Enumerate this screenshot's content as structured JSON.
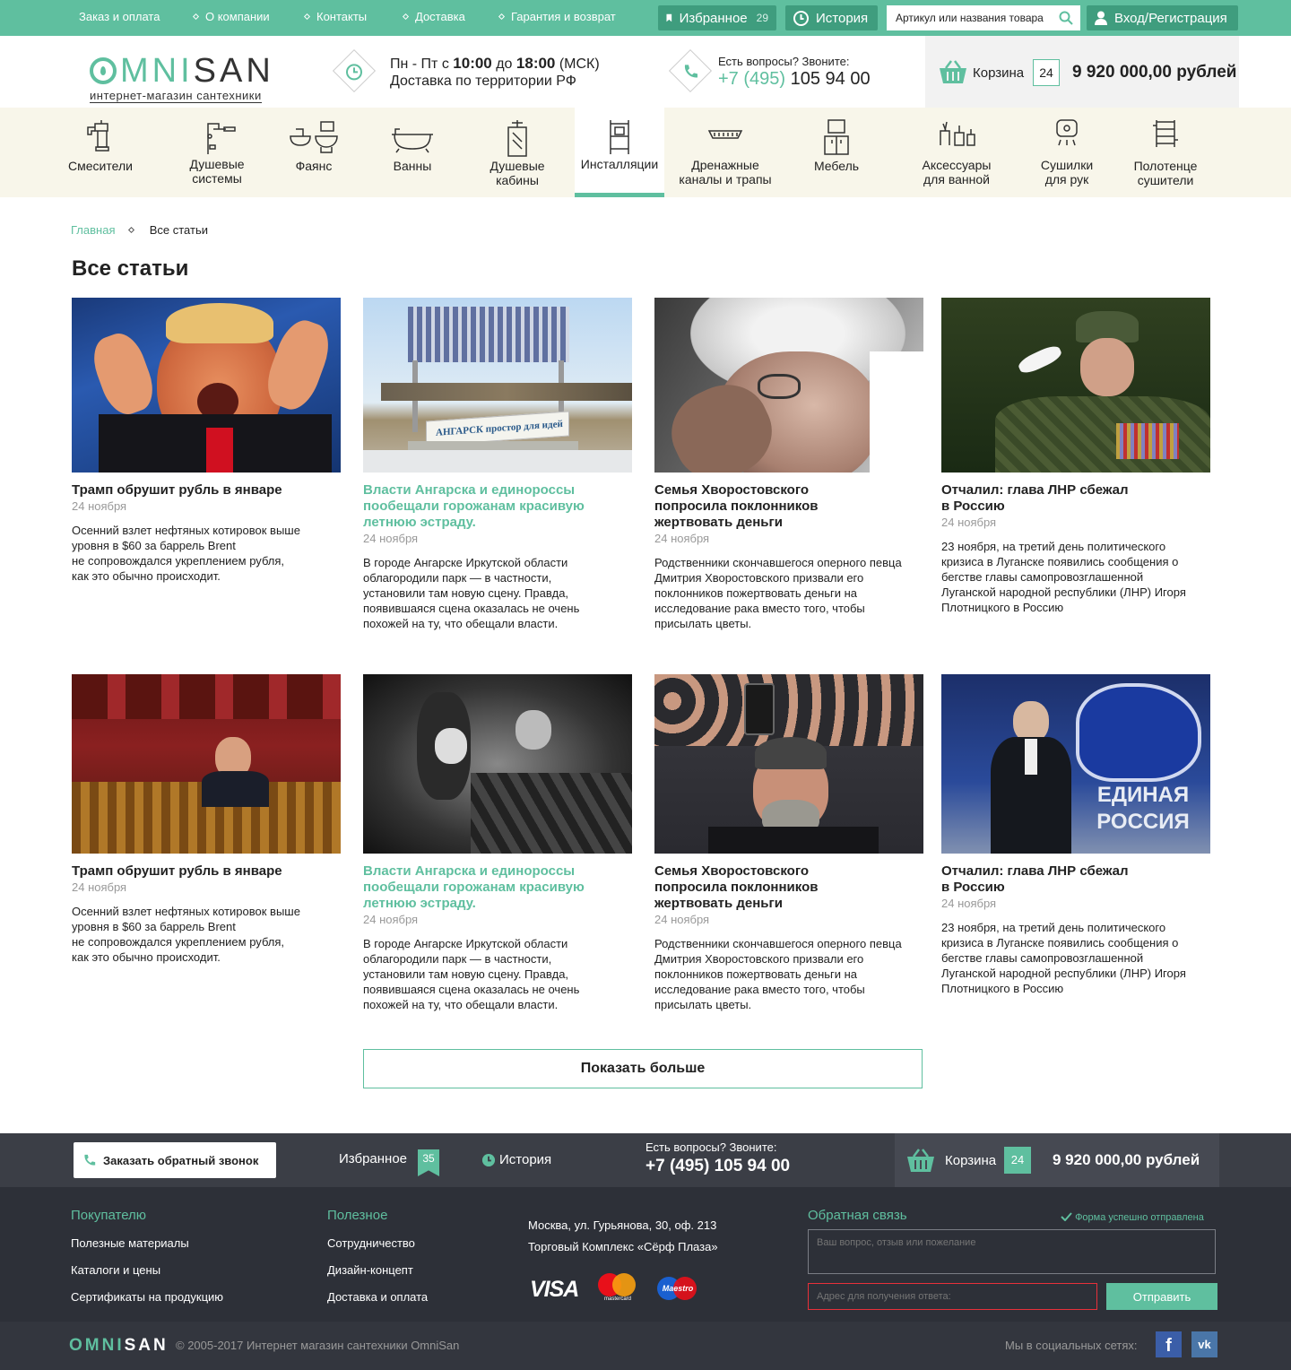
{
  "topbar": {
    "nav": [
      "Заказ и оплата",
      "О компании",
      "Контакты",
      "Доставка",
      "Гарантия и возврат"
    ],
    "favorites_label": "Избранное",
    "favorites_count": "29",
    "history_label": "История",
    "search_placeholder": "Артикул или названия товара",
    "login_label": "Вход/Регистрация"
  },
  "header": {
    "logo_omni_o": "O",
    "logo_mni": "MNI",
    "logo_san": "SAN",
    "logo_sub": "интернет-магазин сантехники",
    "hours_prefix": "Пн - Пт с",
    "hours_from": "10:00",
    "hours_mid": "до",
    "hours_to": "18:00",
    "hours_suffix": "(МСК)",
    "delivery": "Доставка по территории РФ",
    "phone_question": "Есть вопросы? Звоните:",
    "phone_code": "+7 (495)",
    "phone_number": "105 94 00",
    "cart_label": "Корзина",
    "cart_count": "24",
    "cart_total": "9 920 000,00 рублей"
  },
  "categories": [
    {
      "l1": "Смесители",
      "l2": ""
    },
    {
      "l1": "Душевые",
      "l2": "системы"
    },
    {
      "l1": "Фаянс",
      "l2": ""
    },
    {
      "l1": "Ванны",
      "l2": ""
    },
    {
      "l1": "Душевые",
      "l2": "кабины"
    },
    {
      "l1": "Инсталляции",
      "l2": ""
    },
    {
      "l1": "Дренажные",
      "l2": "каналы и трапы"
    },
    {
      "l1": "Мебель",
      "l2": ""
    },
    {
      "l1": "Аксессуары",
      "l2": "для ванной"
    },
    {
      "l1": "Сушилки",
      "l2": "для рук"
    },
    {
      "l1": "Полотенце",
      "l2": "сушители"
    }
  ],
  "breadcrumb": {
    "home": "Главная",
    "current": "Все статьи"
  },
  "page_title": "Все статьи",
  "articles": [
    {
      "t": [
        "Трамп обрушит рубль в январе"
      ],
      "d": "24 ноября",
      "x": [
        "Осенний взлет нефтяных котировок выше",
        "уровня в $60 за баррель Brent",
        "не сопровождался укреплением рубля,",
        "как это обычно происходит."
      ]
    },
    {
      "t": [
        "Власти Ангарска и единороссы",
        "пообещали горожанам красивую",
        "летнюю эстраду."
      ],
      "d": "24 ноября",
      "x": [
        "В городе Ангарске Иркутской области",
        "облагородили парк — в частности,",
        "установили там новую сцену. Правда,",
        "появившаяся сцена оказалась не очень",
        "похожей на ту, что обещали власти."
      ]
    },
    {
      "t": [
        "Семья Хворостовского",
        "попросила поклонников",
        "жертвовать деньги"
      ],
      "d": "24 ноября",
      "x": [
        "Родственники скончавшегося оперного певца",
        "Дмитрия Хворостовского призвали его",
        "поклонников пожертвовать деньги на",
        "исследование рака вместо того, чтобы",
        "присылать цветы."
      ]
    },
    {
      "t": [
        "Отчалил: глава ЛНР сбежал",
        "в Россию"
      ],
      "d": "24 ноября",
      "x": [
        "23 ноября, на третий день политического",
        "кризиса в Луганске появились сообщения о",
        "бегстве главы самопровозглашенной",
        "Луганской народной республики (ЛНР) Игоря",
        "Плотницкого в Россию"
      ]
    }
  ],
  "stage_sign": "АНГАРСК простор для идей",
  "party_sign": [
    "ЕДИНАЯ",
    "РОССИЯ"
  ],
  "show_more": "Показать больше",
  "footer": {
    "callback_btn": "Заказать обратный звонок",
    "favorites_label": "Избранное",
    "favorites_count": "35",
    "history_label": "История",
    "phone_question": "Есть вопросы? Звоните:",
    "phone": "+7 (495) 105 94 00",
    "cart_label": "Корзина",
    "cart_count": "24",
    "cart_total": "9 920 000,00 рублей",
    "col1_title": "Покупателю",
    "col1_links": [
      "Полезные материалы",
      "Каталоги и цены",
      "Сертификаты на продукцию"
    ],
    "col2_title": "Полезное",
    "col2_links": [
      "Сотрудничество",
      "Дизайн-концепт",
      "Доставка и оплата"
    ],
    "address1": "Москва, ул. Гурьянова, 30, оф. 213",
    "address2": "Торговый Комплекс «Сёрф Плаза»",
    "visa": "VISA",
    "mastercard": "mastercard",
    "maestro": "Maestro",
    "feedback_title": "Обратная связь",
    "feedback_success": "Форма успешно отправлена",
    "question_placeholder": "Ваш вопрос, отзыв или пожелание",
    "address_placeholder": "Адрес для получения ответа:",
    "send_btn": "Отправить",
    "copyright": "© 2005-2017 Интернет магазин сантехники OmniSan",
    "logo_omni": "OMNI",
    "logo_san": "SAN",
    "social_label": "Мы в социальных сетях:",
    "fb": "f",
    "vk": "vk"
  },
  "colors": {
    "accent": "#5fbf9f",
    "accent_dark": "#3f9d7e",
    "cat_bg": "#f8f6ea",
    "footer_dark": "#2d3038"
  }
}
